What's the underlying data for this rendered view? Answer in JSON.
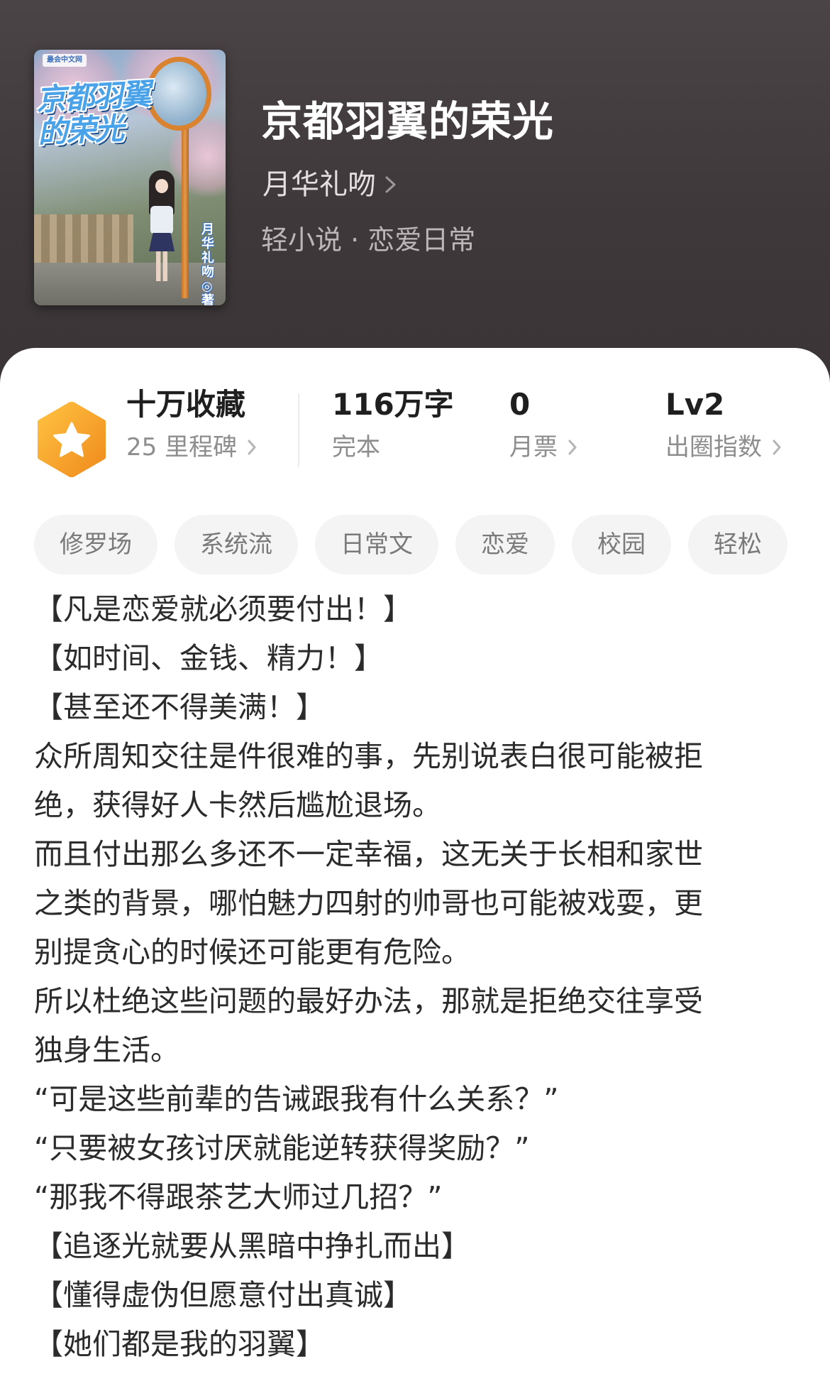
{
  "book": {
    "title": "京都羽翼的荣光",
    "author": "月华礼吻",
    "category_line": "轻小说 · 恋爱日常",
    "cover": {
      "badge": "最会中文网",
      "title_text": "京都羽翼的荣光",
      "author_text": "月华礼吻◎著"
    }
  },
  "stats": [
    {
      "value": "十万收藏",
      "sub": "25 里程碑",
      "has_chevron": true
    },
    {
      "value": "116万字",
      "sub": "完本",
      "has_chevron": false
    },
    {
      "value": "0",
      "sub": "月票",
      "has_chevron": true
    },
    {
      "value": "Lv2",
      "sub": "出圈指数",
      "has_chevron": true
    }
  ],
  "tags": [
    "修罗场",
    "系统流",
    "日常文",
    "恋爱",
    "校园",
    "轻松"
  ],
  "intro_lines": [
    "【凡是恋爱就必须要付出！】",
    "【如时间、金钱、精力！】",
    "【甚至还不得美满！】",
    "众所周知交往是件很难的事，先别说表白很可能被拒",
    "绝，获得好人卡然后尴尬退场。",
    "而且付出那么多还不一定幸福，这无关于长相和家世",
    "之类的背景，哪怕魅力四射的帅哥也可能被戏耍，更",
    "别提贪心的时候还可能更有危险。",
    "所以杜绝这些问题的最好办法，那就是拒绝交往享受",
    "独身生活。",
    "“可是这些前辈的告诫跟我有什么关系？”",
    "“只要被女孩讨厌就能逆转获得奖励？”",
    "“那我不得跟茶艺大师过几招？”",
    "【追逐光就要从黑暗中挣扎而出】",
    "【懂得虚伪但愿意付出真诚】",
    "【她们都是我的羽翼】"
  ],
  "colors": {
    "header_bg": "#3e383a",
    "medal": "#f5a623",
    "tag_bg": "#f4f4f4"
  },
  "icons": [
    "star-medal-icon",
    "chevron-right-icon"
  ]
}
